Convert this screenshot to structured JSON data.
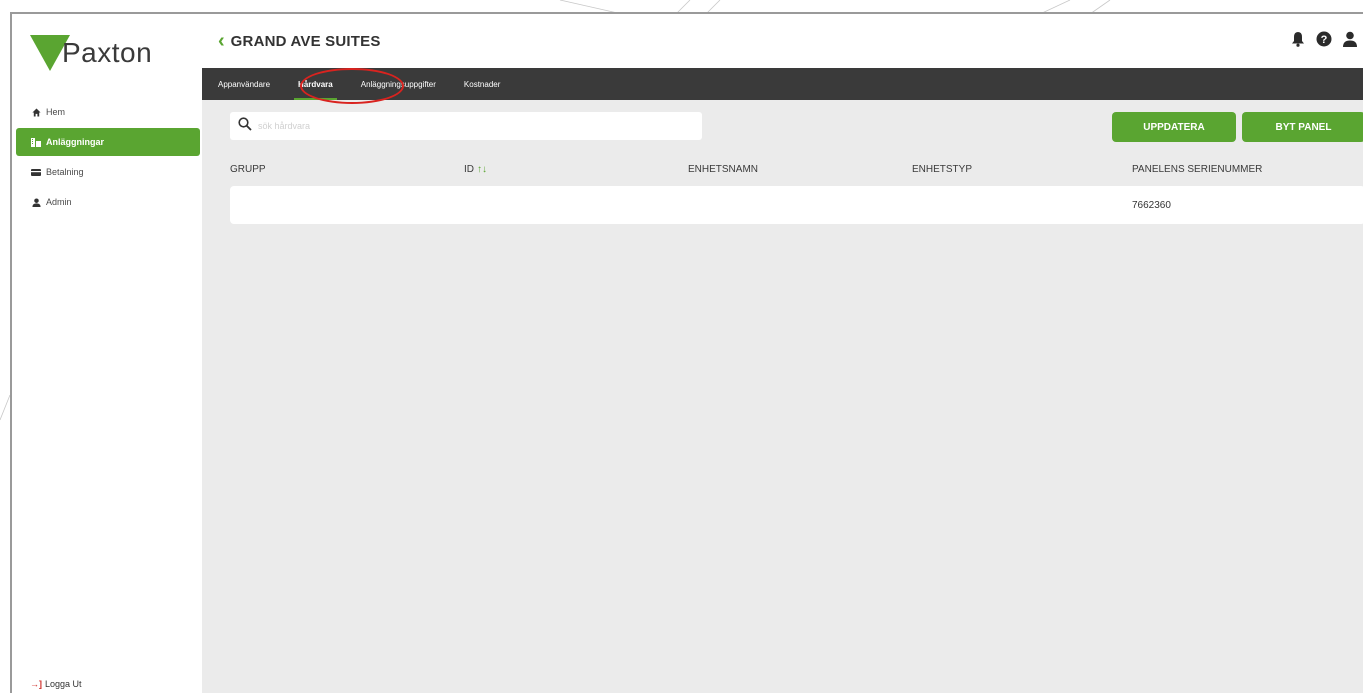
{
  "app": {
    "logo_text": "Paxton",
    "brand_color": "#5aa531"
  },
  "sidebar": {
    "items": [
      {
        "label": "Hem",
        "icon": "home-icon"
      },
      {
        "label": "Anläggningar",
        "icon": "building-icon",
        "active": true
      },
      {
        "label": "Betalning",
        "icon": "credit-card-icon"
      },
      {
        "label": "Admin",
        "icon": "user-icon"
      }
    ],
    "logout_label": "Logga Ut"
  },
  "header": {
    "back_icon": "chevron-left-icon",
    "title": "GRAND AVE SUITES",
    "icons": [
      "bell-icon",
      "help-icon",
      "user-icon"
    ]
  },
  "tabs": [
    {
      "label": "Appanvändare"
    },
    {
      "label": "Hårdvara",
      "active": true
    },
    {
      "label": "Anläggningsuppgifter"
    },
    {
      "label": "Kostnader"
    }
  ],
  "toolbar": {
    "search_placeholder": "sök hårdvara",
    "update_label": "UPPDATERA",
    "change_panel_label": "BYT PANEL"
  },
  "table": {
    "columns": [
      "GRUPP",
      "ID",
      "ENHETSNAMN",
      "ENHETSTYP",
      "PANELENS SERIENUMMER"
    ],
    "sort_icon": "↑↓",
    "rows": [
      {
        "grupp": "",
        "id": "",
        "enhetsnamn": "",
        "enhetstyp": "",
        "serienummer": "7662360"
      }
    ]
  }
}
